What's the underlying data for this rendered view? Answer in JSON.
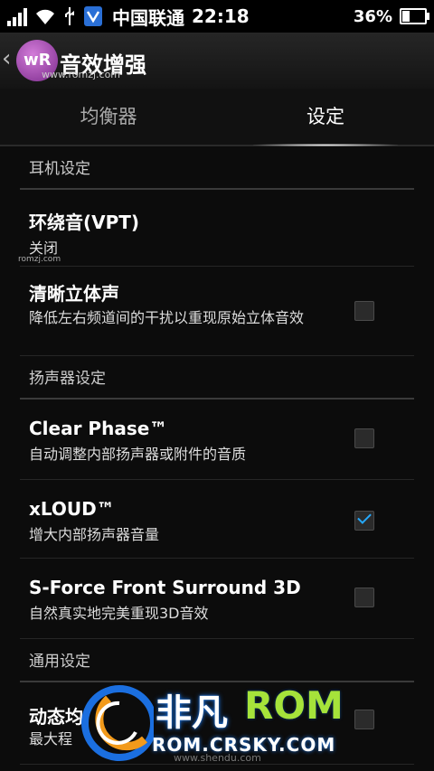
{
  "status": {
    "carrier": "中国联通",
    "time": "22:18",
    "battery": "36%",
    "battery_level": 0.36
  },
  "actionbar": {
    "title": "音效增强",
    "logo_text": "wR",
    "watermark_url": "www.romzj.com"
  },
  "tabs": [
    {
      "label": "均衡器"
    },
    {
      "label": "设定"
    }
  ],
  "sections": {
    "headphone": "耳机设定",
    "speaker": "扬声器设定",
    "general": "通用设定"
  },
  "items": {
    "vpt": {
      "title": "环绕音(VPT)",
      "subtitle": "关闭"
    },
    "clear_stereo": {
      "title": "清晰立体声",
      "subtitle": "降低左右频道间的干扰以重现原始立体音效",
      "checked": false
    },
    "clear_phase": {
      "title": "Clear Phase™",
      "subtitle": "自动调整内部扬声器或附件的音质",
      "checked": false
    },
    "xloud": {
      "title": "xLOUD™",
      "subtitle": "增大内部扬声器音量",
      "checked": true
    },
    "sforce": {
      "title": "S-Force Front Surround 3D",
      "subtitle": "自然真实地完美重现3D音效",
      "checked": false
    },
    "dynamic": {
      "title": "动态均",
      "subtitle": "最大程",
      "checked": false
    }
  },
  "tiny_watermark": "romzj.com",
  "overlay": {
    "cn": "非凡",
    "rom": "ROM",
    "site": "ROM.CRSKY.COM",
    "small": "www.shendu.com"
  }
}
